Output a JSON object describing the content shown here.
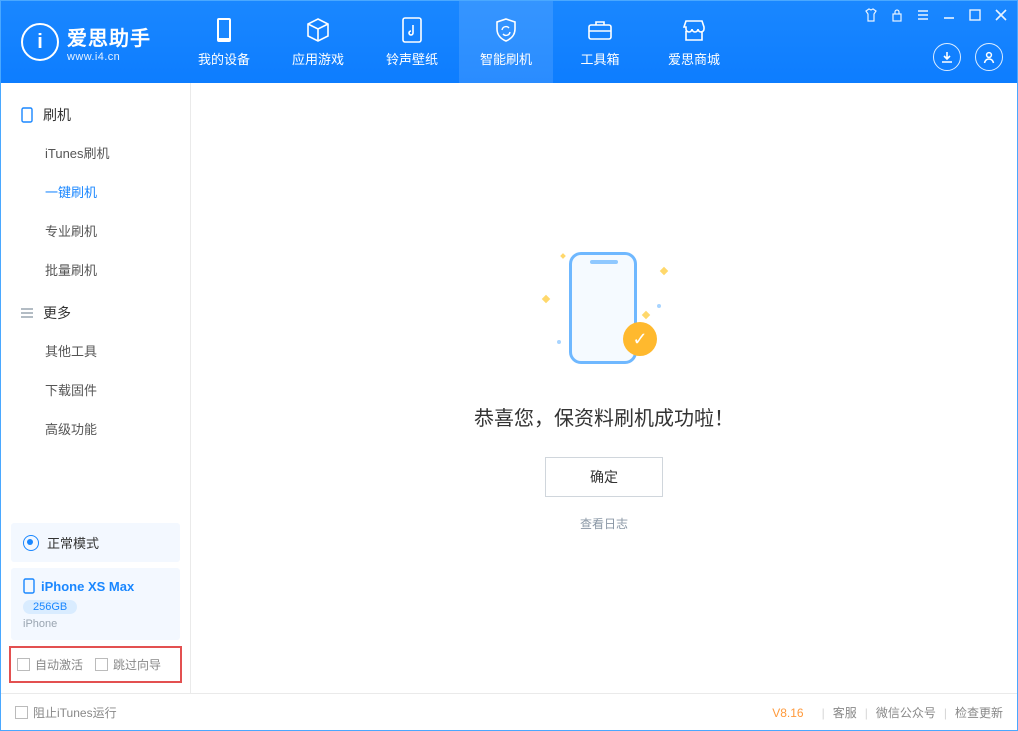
{
  "app": {
    "title": "爱思助手",
    "subtitle": "www.i4.cn",
    "logo_letter": "i"
  },
  "nav": {
    "items": [
      {
        "label": "我的设备",
        "icon": "device"
      },
      {
        "label": "应用游戏",
        "icon": "cube"
      },
      {
        "label": "铃声壁纸",
        "icon": "music"
      },
      {
        "label": "智能刷机",
        "icon": "refresh",
        "active": true
      },
      {
        "label": "工具箱",
        "icon": "toolbox"
      },
      {
        "label": "爱思商城",
        "icon": "store"
      }
    ]
  },
  "sidebar": {
    "section1": {
      "title": "刷机",
      "items": [
        "iTunes刷机",
        "一键刷机",
        "专业刷机",
        "批量刷机"
      ],
      "active_index": 1
    },
    "section2": {
      "title": "更多",
      "items": [
        "其他工具",
        "下载固件",
        "高级功能"
      ]
    },
    "mode": "正常模式",
    "device": {
      "name": "iPhone XS Max",
      "storage": "256GB",
      "type": "iPhone"
    },
    "checks": {
      "auto_activate": "自动激活",
      "skip_guide": "跳过向导"
    }
  },
  "main": {
    "headline": "恭喜您，保资料刷机成功啦！",
    "ok_button": "确定",
    "view_log": "查看日志"
  },
  "statusbar": {
    "block_itunes": "阻止iTunes运行",
    "version": "V8.16",
    "links": [
      "客服",
      "微信公众号",
      "检查更新"
    ]
  }
}
